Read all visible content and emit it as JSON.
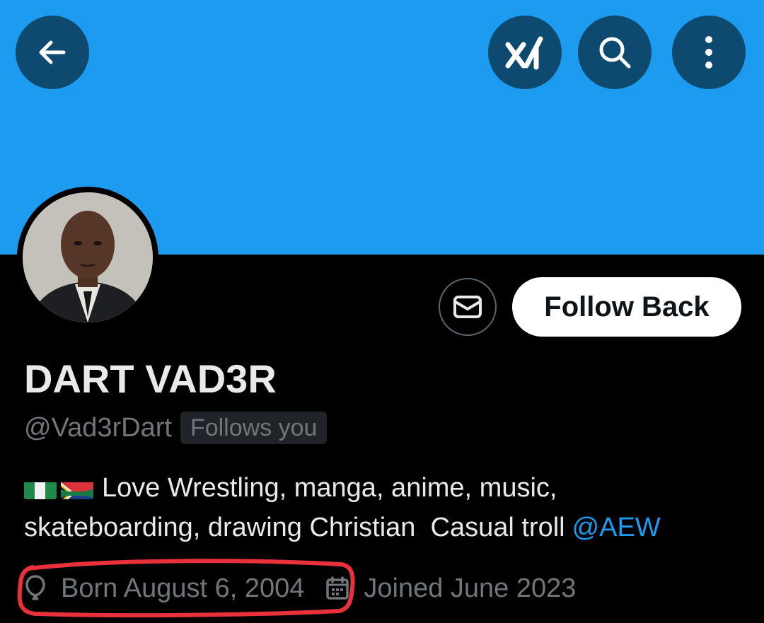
{
  "header": {
    "back_icon": "arrow-left-icon",
    "grok_icon": "grok-icon",
    "search_icon": "search-icon",
    "more_icon": "more-vertical-icon",
    "banner_color": "#1d9bf0",
    "button_color": "#0e4a6f"
  },
  "profile": {
    "display_name": "DART VAD3R",
    "handle": "@Vad3rDart",
    "follows_you": "Follows you",
    "follow_button": "Follow Back",
    "message_icon": "envelope-icon",
    "bio": {
      "flags": [
        "nigeria-flag-icon",
        "south-africa-flag-icon"
      ],
      "line1": "Love Wrestling, manga, anime, music,",
      "line2": "skateboarding, drawing Christian  Casual troll",
      "mention": "@AEW"
    },
    "birthday": "Born August 6, 2004",
    "joined": "Joined June 2023"
  },
  "colors": {
    "text_primary": "#e7e9ea",
    "text_secondary": "#71767b",
    "link": "#1d9bf0",
    "annotation": "#e8313a"
  }
}
